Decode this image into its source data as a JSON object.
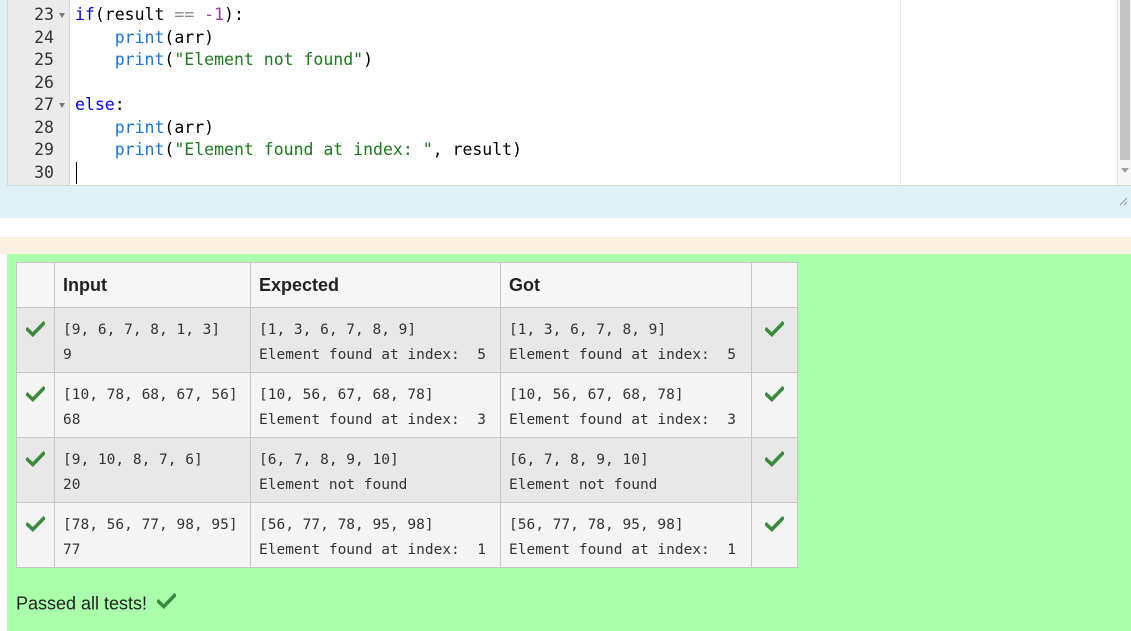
{
  "editor": {
    "lines": [
      {
        "no": "23",
        "fold": true,
        "tokens": [
          {
            "t": "kw",
            "v": "if"
          },
          {
            "t": "dk",
            "v": "(result "
          },
          {
            "t": "op",
            "v": "=="
          },
          {
            "t": "dk",
            "v": " "
          },
          {
            "t": "num",
            "v": "-1"
          },
          {
            "t": "dk",
            "v": "):"
          }
        ]
      },
      {
        "no": "24",
        "fold": false,
        "tokens": [
          {
            "t": "dk",
            "v": "    "
          },
          {
            "t": "fn",
            "v": "print"
          },
          {
            "t": "dk",
            "v": "(arr)"
          }
        ]
      },
      {
        "no": "25",
        "fold": false,
        "tokens": [
          {
            "t": "dk",
            "v": "    "
          },
          {
            "t": "fn",
            "v": "print"
          },
          {
            "t": "dk",
            "v": "("
          },
          {
            "t": "str",
            "v": "\"Element not found\""
          },
          {
            "t": "dk",
            "v": ")"
          }
        ]
      },
      {
        "no": "26",
        "fold": false,
        "tokens": []
      },
      {
        "no": "27",
        "fold": true,
        "tokens": [
          {
            "t": "kw",
            "v": "else"
          },
          {
            "t": "dk",
            "v": ":"
          }
        ]
      },
      {
        "no": "28",
        "fold": false,
        "tokens": [
          {
            "t": "dk",
            "v": "    "
          },
          {
            "t": "fn",
            "v": "print"
          },
          {
            "t": "dk",
            "v": "(arr)"
          }
        ]
      },
      {
        "no": "29",
        "fold": false,
        "tokens": [
          {
            "t": "dk",
            "v": "    "
          },
          {
            "t": "fn",
            "v": "print"
          },
          {
            "t": "dk",
            "v": "("
          },
          {
            "t": "str",
            "v": "\"Element found at index: \""
          },
          {
            "t": "dk",
            "v": ", result)"
          }
        ]
      },
      {
        "no": "30",
        "fold": false,
        "tokens": []
      }
    ]
  },
  "results": {
    "headers": {
      "input": "Input",
      "expected": "Expected",
      "got": "Got"
    },
    "rows": [
      {
        "input": [
          "[9, 6, 7, 8, 1, 3]",
          "9"
        ],
        "expected": [
          "[1, 3, 6, 7, 8, 9]",
          "Element found at index:  5"
        ],
        "got": [
          "[1, 3, 6, 7, 8, 9]",
          "Element found at index:  5"
        ]
      },
      {
        "input": [
          "[10, 78, 68, 67, 56]",
          "68"
        ],
        "expected": [
          "[10, 56, 67, 68, 78]",
          "Element found at index:  3"
        ],
        "got": [
          "[10, 56, 67, 68, 78]",
          "Element found at index:  3"
        ]
      },
      {
        "input": [
          "[9, 10, 8, 7, 6]",
          "20"
        ],
        "expected": [
          "[6, 7, 8, 9, 10]",
          "Element not found"
        ],
        "got": [
          "[6, 7, 8, 9, 10]",
          "Element not found"
        ]
      },
      {
        "input": [
          "[78, 56, 77, 98, 95]",
          "77"
        ],
        "expected": [
          "[56, 77, 78, 95, 98]",
          "Element found at index:  1"
        ],
        "got": [
          "[56, 77, 78, 95, 98]",
          "Element found at index:  1"
        ]
      }
    ],
    "passed_text": "Passed all tests!",
    "tick_color": "#3c8a3c"
  }
}
